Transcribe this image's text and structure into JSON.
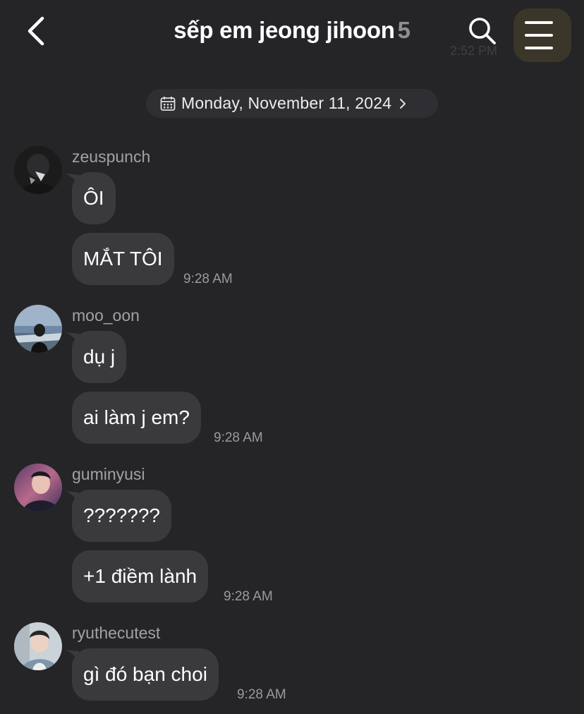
{
  "header": {
    "title": "sếp em jeong jihoon",
    "member_count": "5",
    "behind_time": "2:52 PM"
  },
  "date_divider": {
    "label": "Monday, November 11, 2024"
  },
  "messages": [
    {
      "sender": "zeuspunch",
      "bubbles": [
        "ÔI",
        "MẮT TÔI"
      ],
      "time": "9:28 AM"
    },
    {
      "sender": "moo_oon",
      "bubbles": [
        "dụ j",
        "ai làm j em?"
      ],
      "time": "9:28 AM"
    },
    {
      "sender": "guminyusi",
      "bubbles": [
        "???????",
        "+1 điềm lành"
      ],
      "time": "9:28 AM"
    },
    {
      "sender": "ryuthecutest",
      "bubbles": [
        "gì đó bạn choi"
      ],
      "time": "9:28 AM"
    }
  ],
  "colors": {
    "background": "#252528",
    "bubble": "#3a3a3d",
    "menu_button": "#3a3629",
    "secondary_text": "#a1a1a6"
  },
  "icons": [
    "back-chevron-icon",
    "search-icon",
    "hamburger-menu-icon",
    "calendar-icon",
    "chevron-right-icon"
  ]
}
